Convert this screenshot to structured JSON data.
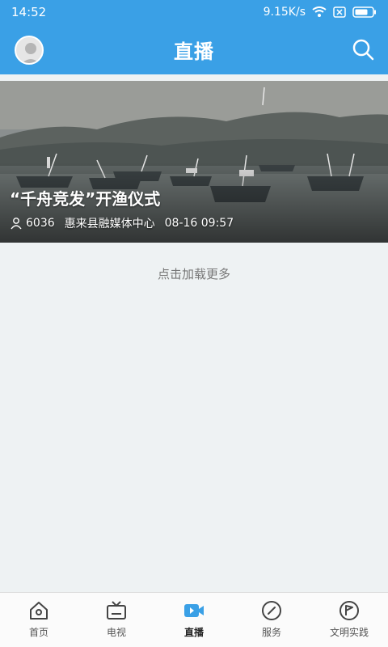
{
  "status": {
    "time": "14:52",
    "speed": "9.15K/s"
  },
  "header": {
    "title": "直播"
  },
  "live_item": {
    "title": "“千舟竞发”开渔仪式",
    "viewers": "6036",
    "source": "惠来县融媒体中心",
    "datetime": "08-16 09:57"
  },
  "load_more": "点击加载更多",
  "tabs": [
    {
      "label": "首页",
      "icon": "home-icon"
    },
    {
      "label": "电视",
      "icon": "tv-icon"
    },
    {
      "label": "直播",
      "icon": "live-video-icon",
      "active": true
    },
    {
      "label": "服务",
      "icon": "compass-icon"
    },
    {
      "label": "文明实践",
      "icon": "flag-icon"
    }
  ],
  "colors": {
    "brand": "#3aa0e6",
    "active_tab": "#3aa0e6"
  }
}
